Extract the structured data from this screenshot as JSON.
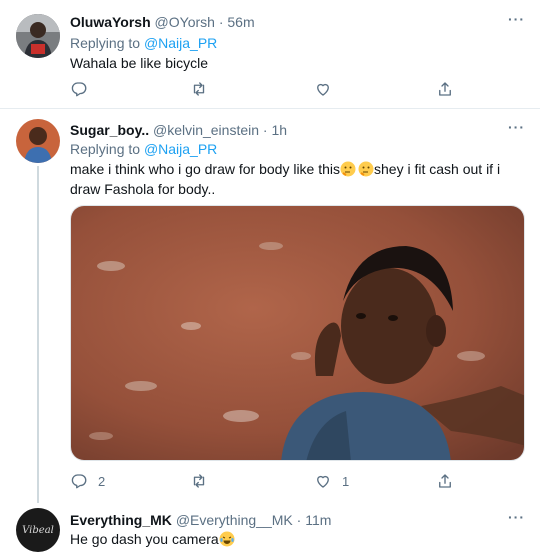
{
  "tweets": [
    {
      "name": "OluwaYorsh",
      "handle": "@OYorsh",
      "sep": " · ",
      "time": "56m",
      "replying_prefix": "Replying to ",
      "replying_to": "@Naija_PR",
      "text": "Wahala be like bicycle",
      "avatar_icon": "user-photo-icon"
    },
    {
      "name": "Sugar_boy..",
      "handle": "@kelvin_einstein",
      "sep": " · ",
      "time": "1h",
      "replying_prefix": "Replying to ",
      "replying_to": "@Naija_PR",
      "text_part1": "make i think who i go draw for body like this",
      "text_part2": "shey i fit cash out if i",
      "text_line2": "draw Fashola for body..",
      "reply_count": "2",
      "like_count": "1",
      "media_icon": "meme-photo-icon",
      "emoji_icon": "thinking-face-icon"
    },
    {
      "name": "Everything_MK",
      "handle": "@Everything__MK",
      "sep": " · ",
      "time": "11m",
      "text": "He go dash you camera",
      "avatar_text": "Vibeal",
      "emoji_icon": "laughing-tears-icon"
    }
  ],
  "colors": {
    "link": "#1da1f2",
    "muted": "#5b7083",
    "text": "#0f1419",
    "divider": "#e6ecf0"
  }
}
